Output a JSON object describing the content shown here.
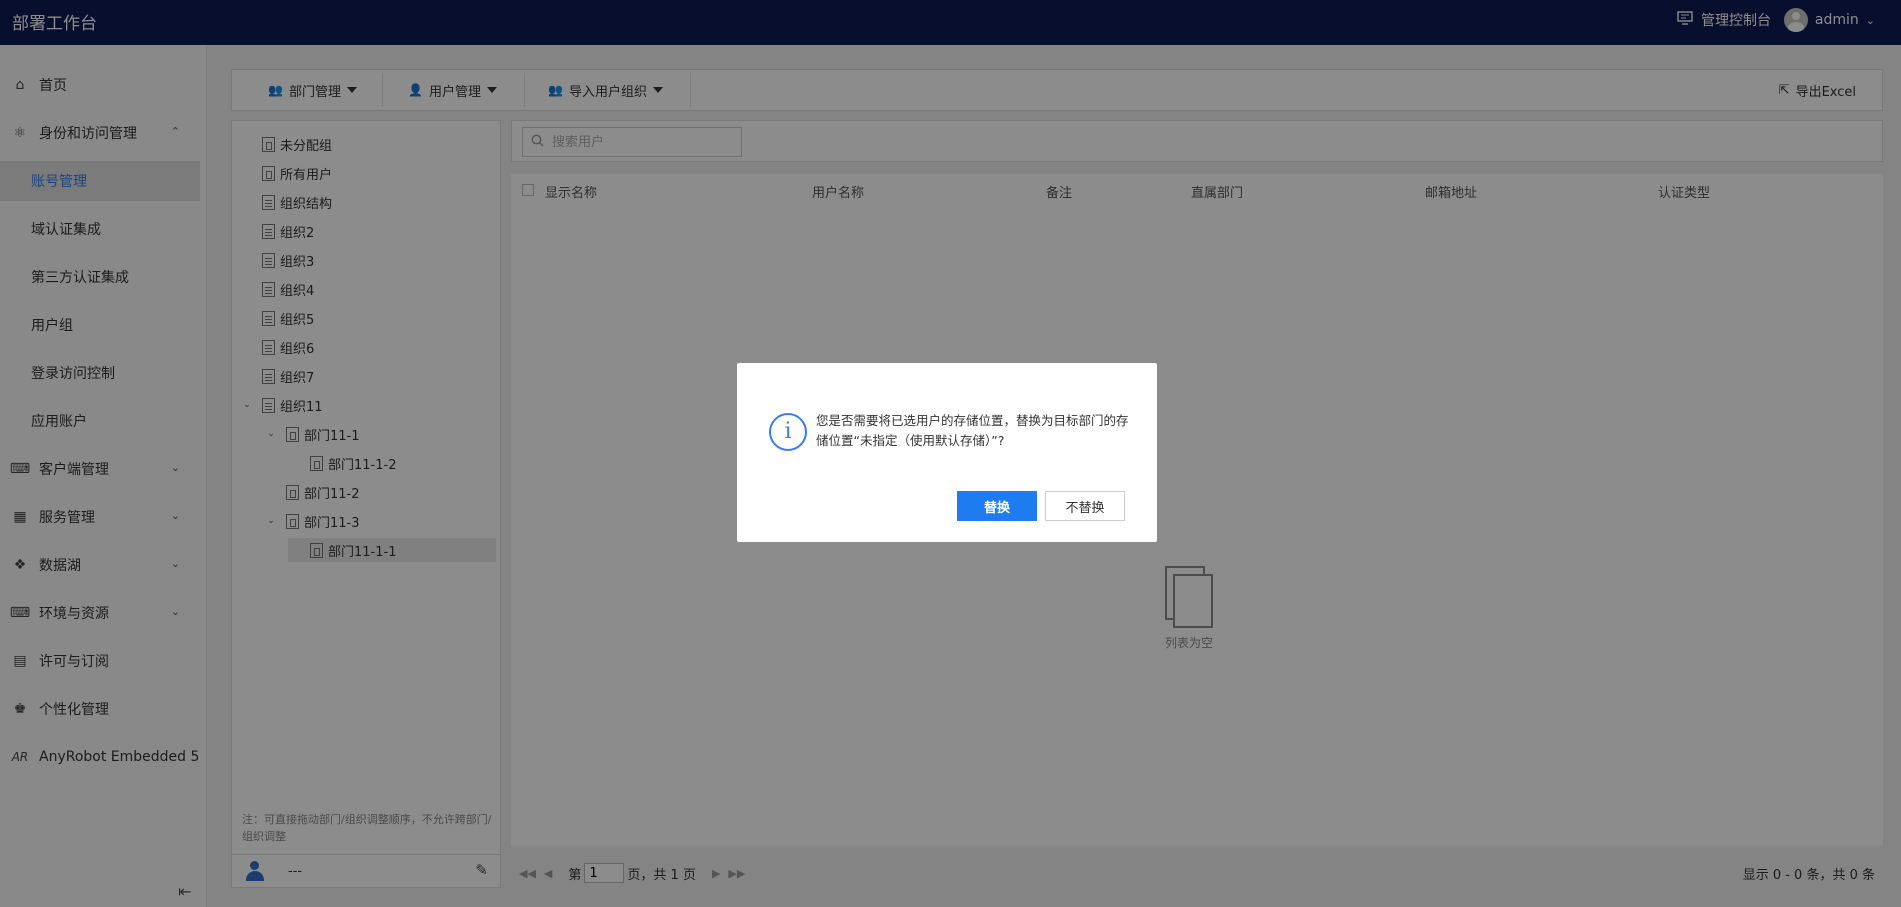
{
  "header": {
    "app_title": "部署工作台",
    "console_label": "管理控制台",
    "user_name": "admin"
  },
  "sidebar": {
    "home": "首页",
    "identity_group": "身份和访问管理",
    "sub_items": [
      "账号管理",
      "域认证集成",
      "第三方认证集成",
      "用户组",
      "登录访问控制",
      "应用账户"
    ],
    "active_sub": "账号管理",
    "groups": [
      "客户端管理",
      "服务管理",
      "数据湖",
      "环境与资源",
      "许可与订阅",
      "个性化管理",
      "AnyRobot Embedded 5"
    ]
  },
  "toolbar": {
    "dept_mgmt": "部门管理",
    "user_mgmt": "用户管理",
    "import_org": "导入用户组织",
    "export": "导出Excel"
  },
  "tree": {
    "nodes": [
      "未分配组",
      "所有用户",
      "组织结构",
      "组织2",
      "组织3",
      "组织4",
      "组织5",
      "组织6",
      "组织7",
      "组织11",
      "部门11-1",
      "部门11-1-2",
      "部门11-2",
      "部门11-3",
      "部门11-1-1"
    ],
    "note": "注：可直接拖动部门/组织调整顺序，不允许跨部门/组织调整",
    "footer_text": "---"
  },
  "search": {
    "placeholder": "搜索用户"
  },
  "grid": {
    "columns": [
      "显示名称",
      "用户名称",
      "备注",
      "直属部门",
      "邮箱地址",
      "认证类型"
    ],
    "empty_text": "列表为空"
  },
  "pager": {
    "prefix": "第",
    "page": "1",
    "suffix": "页，共 1 页",
    "summary": "显示 0 - 0 条，共 0 条"
  },
  "dialog": {
    "message": "您是否需要将已选用户的存储位置，替换为目标部门的存储位置“未指定（使用默认存储）”?",
    "confirm": "替换",
    "cancel": "不替换"
  },
  "colors": {
    "topbar": "#0f1a52",
    "accent": "#1f7cf0",
    "active_text": "#2d7de8"
  }
}
